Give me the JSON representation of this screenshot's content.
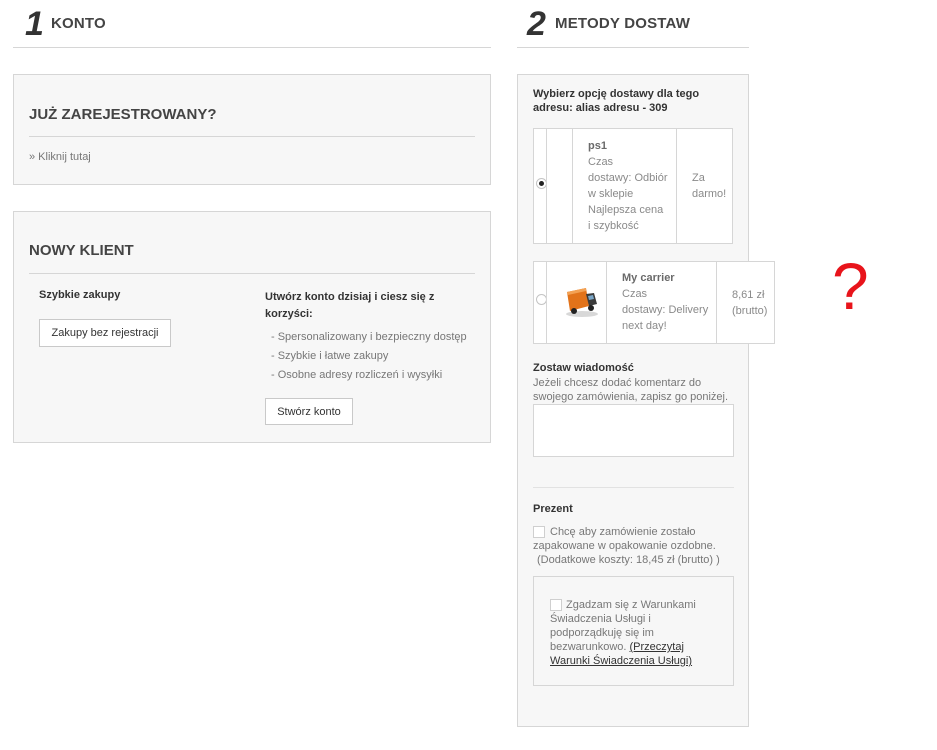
{
  "step1": {
    "number": "1",
    "title": "KONTO"
  },
  "step2": {
    "number": "2",
    "title": "METODY DOSTAW"
  },
  "registered": {
    "title": "JUŻ ZAREJESTROWANY?",
    "link": "» Kliknij tutaj"
  },
  "new_client": {
    "title": "NOWY KLIENT",
    "quick_title": "Szybkie zakupy",
    "guest_button": "Zakupy bez rejestracji",
    "create_title_l1": "Utwórz konto dzisiaj i ciesz się z",
    "create_title_l2": "korzyści:",
    "benefits": [
      "- Spersonalizowany i bezpieczny dostęp",
      "- Szybkie i łatwe zakupy",
      "- Osobne adresy rozliczeń i wysyłki"
    ],
    "create_button": "Stwórz konto"
  },
  "shipping": {
    "heading_l1": "Wybierz opcję dostawy dla tego",
    "heading_l2": "adresu: alias adresu - 309",
    "carriers": [
      {
        "name": "ps1",
        "lines": [
          "Czas",
          "dostawy: Odbiór",
          "w sklepie",
          "Najlepsza cena",
          "i szybkość"
        ],
        "price_l1": "Za",
        "price_l2": "darmo!",
        "selected": true
      },
      {
        "name": "My carrier",
        "lines": [
          "Czas",
          "dostawy: Delivery",
          "next day!"
        ],
        "price_l1": "8,61 zł",
        "price_l2": "(brutto)",
        "icon": "truck-icon",
        "selected": false
      }
    ],
    "message_title": "Zostaw wiadomość",
    "message_desc_l1": "Jeżeli chcesz dodać komentarz do",
    "message_desc_l2": "swojego zamówienia, zapisz go poniżej.",
    "message_value": "",
    "gift_title": "Prezent",
    "gift_l1": "Chcę aby zamówienie zostało",
    "gift_l2": "zapakowane w opakowanie ozdobne.",
    "gift_l3": "(Dodatkowe koszty: 18,45 zł (brutto) )",
    "terms_l1": "Zgadzam się z Warunkami",
    "terms_l2": "Świadczenia Usługi i",
    "terms_l3": "podporządkuję się im",
    "terms_l4": "bezwarunkowo.",
    "terms_link_l1": "(Przeczytaj",
    "terms_link_l2": "Warunki Świadczenia Usługi)"
  },
  "question_mark": "?",
  "colors": {
    "accent_question": "#e8141b",
    "panel_bg": "#f7f7f7",
    "border": "#d6d6d6"
  }
}
